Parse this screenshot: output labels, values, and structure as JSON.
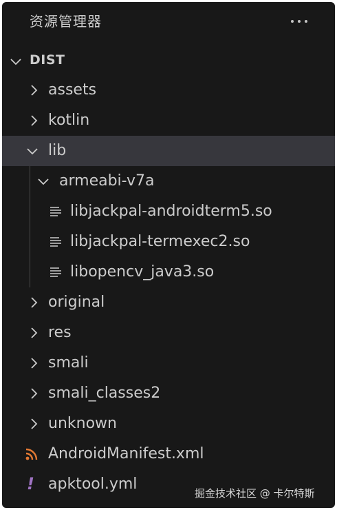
{
  "explorer": {
    "title": "资源管理器",
    "more_actions_icon": "ellipsis-icon",
    "root_folder": "DIST",
    "items": [
      {
        "name": "assets"
      },
      {
        "name": "kotlin"
      },
      {
        "name": "lib"
      },
      {
        "name": "armeabi-v7a"
      },
      {
        "name": "libjackpal-androidterm5.so"
      },
      {
        "name": "libjackpal-termexec2.so"
      },
      {
        "name": "libopencv_java3.so"
      },
      {
        "name": "original"
      },
      {
        "name": "res"
      },
      {
        "name": "smali"
      },
      {
        "name": "smali_classes2"
      },
      {
        "name": "unknown"
      },
      {
        "name": "AndroidManifest.xml"
      },
      {
        "name": "apktool.yml"
      }
    ]
  },
  "colors": {
    "panel_bg": "#181818",
    "selected_bg": "#37373d",
    "text": "#cccccc",
    "xml_icon": "#e37933",
    "yml_icon": "#a074c4"
  },
  "watermark": "掘金技术社区 @ 卡尔特斯"
}
